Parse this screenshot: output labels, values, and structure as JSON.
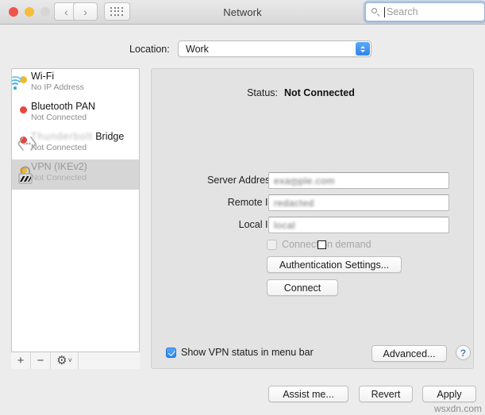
{
  "window": {
    "title": "Network",
    "traffic_lights": [
      "close",
      "minimize",
      "zoom"
    ],
    "back_glyph": "‹",
    "forward_glyph": "›",
    "grid_icon": "show-all-icon"
  },
  "search": {
    "placeholder": "Search",
    "value": "",
    "icon": "search-icon"
  },
  "location": {
    "label": "Location:",
    "selected": "Work"
  },
  "sidebar": {
    "services": [
      {
        "name": "Wi-Fi",
        "status": "No IP Address",
        "dot_color": "#f0b92c",
        "icon": "wifi-icon",
        "selected": false,
        "blurred_prefix": ""
      },
      {
        "name": "Bluetooth PAN",
        "status": "Not Connected",
        "dot_color": "#e8453c",
        "icon": "bluetooth-icon",
        "selected": false,
        "blurred_prefix": ""
      },
      {
        "name": "Bridge",
        "status": "Not Connected",
        "dot_color": "#e8453c",
        "icon": "bridge-icon",
        "selected": false,
        "blurred_prefix": "Thunderbolt"
      },
      {
        "name": "VPN (IKEv2)",
        "status": "Not Connected",
        "dot_color": "#f0b92c",
        "icon": "vpn-lock-icon",
        "selected": true,
        "blurred_prefix": ""
      }
    ],
    "toolbar": {
      "add": "+",
      "remove": "−",
      "gear": "⚙",
      "gear_chevron": "˅"
    }
  },
  "main": {
    "status_label": "Status:",
    "status_value": "Not Connected",
    "fields": [
      {
        "label": "Server Address:",
        "value": "exam̲ple.com",
        "blurred": true
      },
      {
        "label": "Remote ID:",
        "value": "redacted",
        "blurred": true
      },
      {
        "label": "Local ID:",
        "value": "local",
        "blurred": true
      }
    ],
    "connect_on_demand": {
      "label": "Connect on demand",
      "checked": false,
      "disabled": true
    },
    "auth_button": "Authentication Settings...",
    "connect_button": "Connect",
    "show_vpn_status": {
      "label": "Show VPN status in menu bar",
      "checked": true
    },
    "advanced_button": "Advanced...",
    "help_button": "?"
  },
  "footer": {
    "assist_button": "Assist me...",
    "revert_button": "Revert",
    "apply_button": "Apply"
  },
  "watermark": "wsxdn.com"
}
